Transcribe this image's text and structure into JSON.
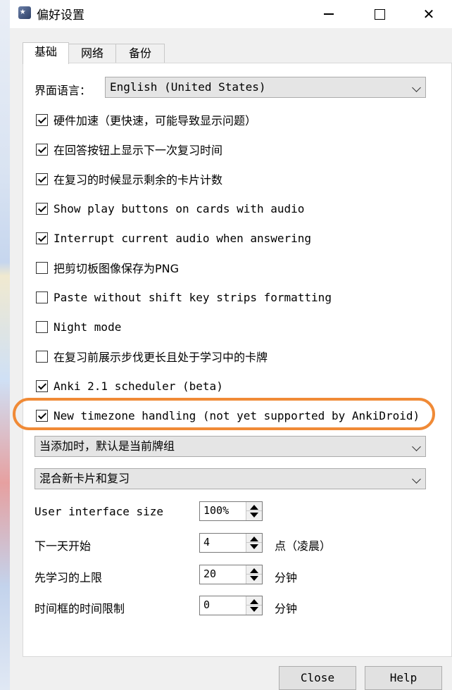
{
  "window": {
    "title": "偏好设置"
  },
  "tabs": [
    {
      "label": "基础",
      "active": true
    },
    {
      "label": "网络",
      "active": false
    },
    {
      "label": "备份",
      "active": false
    }
  ],
  "language": {
    "label": "界面语言：",
    "selected": "English (United States)"
  },
  "options": [
    {
      "label": "硬件加速（更快速，可能导致显示问题）",
      "checked": true
    },
    {
      "label": "在回答按钮上显示下一次复习时间",
      "checked": true
    },
    {
      "label": "在复习的时候显示剩余的卡片计数",
      "checked": true
    },
    {
      "label": "Show play buttons on cards with audio",
      "checked": true
    },
    {
      "label": "Interrupt current audio when answering",
      "checked": true
    },
    {
      "label": "把剪切板图像保存为PNG",
      "checked": false
    },
    {
      "label": "Paste without shift key strips formatting",
      "checked": false
    },
    {
      "label": "Night mode",
      "checked": false
    },
    {
      "label": "在复习前展示步伐更长且处于学习中的卡牌",
      "checked": false
    },
    {
      "label": "Anki 2.1 scheduler (beta)",
      "checked": true
    },
    {
      "label": "New timezone handling (not yet supported by AnkiDroid)",
      "checked": true
    }
  ],
  "dropdowns": {
    "add_default": "当添加时，默认是当前牌组",
    "mix_mode": "混合新卡片和复习"
  },
  "settings": {
    "ui_size_label": "User interface size",
    "ui_size_value": "100%",
    "next_day_label": "下一天开始",
    "next_day_value": "4",
    "next_day_unit": "点（凌晨）",
    "learn_ahead_label": "先学习的上限",
    "learn_ahead_value": "20",
    "learn_ahead_unit": "分钟",
    "timebox_label": "时间框的时间限制",
    "timebox_value": "0",
    "timebox_unit": "分钟"
  },
  "buttons": {
    "close": "Close",
    "help": "Help"
  },
  "colors": {
    "annotation": "#f08a36"
  }
}
